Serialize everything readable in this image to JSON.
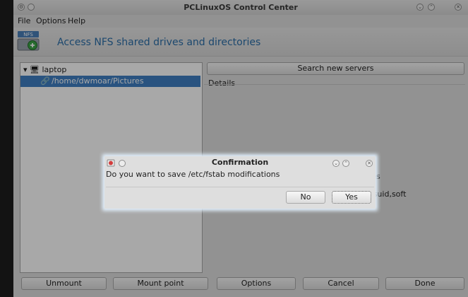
{
  "window": {
    "title": "PCLinuxOS Control Center"
  },
  "menu": {
    "items": [
      "File",
      "Options",
      "Help"
    ]
  },
  "header": {
    "icon_label": "NFS",
    "title": "Access NFS shared drives and directories"
  },
  "tree": {
    "root_label": "laptop",
    "selected_item": "/home/dwmoar/Pictures"
  },
  "search_button": "Search new servers",
  "details": {
    "label": "Details",
    "partial_text_1": "ures",
    "partial_text_2": "nosuid,soft"
  },
  "bottom_buttons": {
    "unmount": "Unmount",
    "mount_point": "Mount point",
    "options": "Options",
    "cancel": "Cancel",
    "done": "Done"
  },
  "dialog": {
    "title": "Confirmation",
    "message": "Do you want to save /etc/fstab modifications",
    "no": "No",
    "yes": "Yes"
  },
  "colors": {
    "accent": "#3f7fc2",
    "header_text": "#2b6ea8",
    "dialog_glow": "#e3f2ff"
  }
}
